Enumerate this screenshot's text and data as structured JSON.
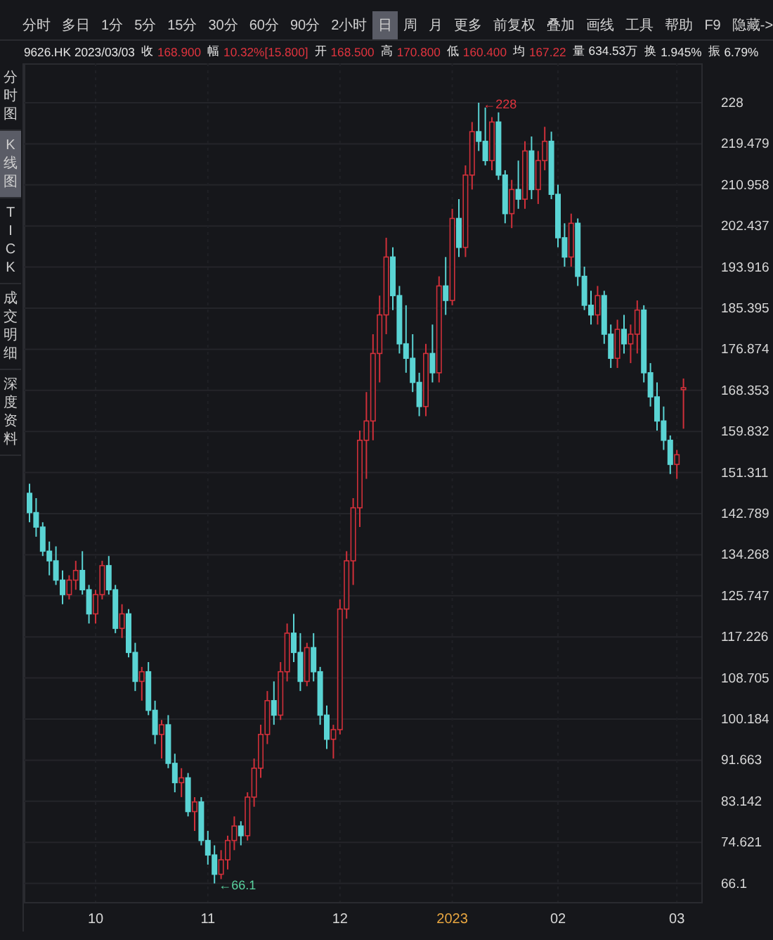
{
  "periods": [
    {
      "label": "分时",
      "selected": false
    },
    {
      "label": "多日",
      "selected": false
    },
    {
      "label": "1分",
      "selected": false
    },
    {
      "label": "5分",
      "selected": false
    },
    {
      "label": "15分",
      "selected": false
    },
    {
      "label": "30分",
      "selected": false
    },
    {
      "label": "60分",
      "selected": false
    },
    {
      "label": "90分",
      "selected": false
    },
    {
      "label": "2小时",
      "selected": false
    },
    {
      "label": "日",
      "selected": true
    },
    {
      "label": "周",
      "selected": false
    },
    {
      "label": "月",
      "selected": false
    },
    {
      "label": "更多",
      "selected": false
    }
  ],
  "tools": [
    "前复权",
    "叠加",
    "画线",
    "工具",
    "帮助",
    "F9",
    "隐藏->"
  ],
  "quote": {
    "symbol": "9626.HK",
    "date": "2023/03/03",
    "fields": [
      {
        "label": "收",
        "value": "168.900",
        "color": "#e0343e"
      },
      {
        "label": "幅",
        "value": "10.32%[15.800]",
        "color": "#e0343e"
      },
      {
        "label": "开",
        "value": "168.500",
        "color": "#e0343e"
      },
      {
        "label": "高",
        "value": "170.800",
        "color": "#e0343e"
      },
      {
        "label": "低",
        "value": "160.400",
        "color": "#e0343e"
      },
      {
        "label": "均",
        "value": "167.22",
        "color": "#e0343e"
      },
      {
        "label": "量",
        "value": "634.53万",
        "color": "#e6e6e6"
      },
      {
        "label": "换",
        "value": "1.945%",
        "color": "#e6e6e6"
      },
      {
        "label": "振",
        "value": "6.79%",
        "color": "#e6e6e6"
      }
    ]
  },
  "x_axis": [
    {
      "label": "10",
      "kind": "month"
    },
    {
      "label": "11",
      "kind": "month"
    },
    {
      "label": "12",
      "kind": "month"
    },
    {
      "label": "2023",
      "kind": "year"
    },
    {
      "label": "02",
      "kind": "month"
    },
    {
      "label": "03",
      "kind": "month"
    }
  ],
  "markers": [
    {
      "label": "←228",
      "kind": "high"
    },
    {
      "label": "←66.1",
      "kind": "low"
    }
  ],
  "side_tabs": [
    {
      "label": "分时图",
      "selected": false
    },
    {
      "label": "K线图",
      "selected": true
    },
    {
      "label": "TICK",
      "selected": false
    },
    {
      "label": "成交明细",
      "selected": false
    },
    {
      "label": "深度资料",
      "selected": false
    }
  ],
  "chart_data": {
    "type": "candlestick",
    "ylim": [
      66.1,
      228
    ],
    "yticks": [
      228,
      219.479,
      210.958,
      202.437,
      193.916,
      185.395,
      176.874,
      168.353,
      159.832,
      151.311,
      142.789,
      134.268,
      125.747,
      117.226,
      108.705,
      100.184,
      91.663,
      83.142,
      74.621,
      66.1
    ],
    "grid": true,
    "ohlc": [
      [
        147,
        149,
        141,
        143
      ],
      [
        143,
        146,
        138,
        140
      ],
      [
        140,
        141,
        134,
        135
      ],
      [
        135,
        137,
        130,
        133
      ],
      [
        133,
        136,
        128,
        129
      ],
      [
        129,
        131,
        124,
        126
      ],
      [
        126,
        130,
        125,
        129
      ],
      [
        129,
        133,
        127,
        131
      ],
      [
        131,
        135,
        126,
        127
      ],
      [
        127,
        128,
        120,
        122
      ],
      [
        122,
        127,
        120,
        126
      ],
      [
        126,
        133,
        125,
        132
      ],
      [
        132,
        134,
        126,
        127
      ],
      [
        127,
        128,
        118,
        119
      ],
      [
        119,
        124,
        117,
        122
      ],
      [
        122,
        123,
        113,
        114
      ],
      [
        114,
        116,
        106,
        108
      ],
      [
        108,
        111,
        104,
        110
      ],
      [
        110,
        112,
        101,
        102
      ],
      [
        102,
        104,
        95,
        97
      ],
      [
        97,
        100,
        92,
        99
      ],
      [
        99,
        101,
        90,
        91
      ],
      [
        91,
        93,
        85,
        87
      ],
      [
        87,
        90,
        84,
        88
      ],
      [
        88,
        89,
        80,
        81
      ],
      [
        81,
        84,
        77,
        83
      ],
      [
        83,
        84,
        74,
        75
      ],
      [
        75,
        77,
        70,
        72
      ],
      [
        72,
        74,
        66.1,
        68
      ],
      [
        68,
        73,
        67,
        71
      ],
      [
        71,
        76,
        69,
        75
      ],
      [
        75,
        80,
        73,
        78
      ],
      [
        78,
        79,
        74,
        76
      ],
      [
        76,
        85,
        75,
        84
      ],
      [
        84,
        92,
        82,
        90
      ],
      [
        90,
        99,
        88,
        97
      ],
      [
        97,
        106,
        95,
        104
      ],
      [
        104,
        108,
        99,
        101
      ],
      [
        101,
        112,
        100,
        110
      ],
      [
        110,
        120,
        108,
        118
      ],
      [
        118,
        122,
        112,
        114
      ],
      [
        114,
        118,
        106,
        108
      ],
      [
        108,
        116,
        107,
        115
      ],
      [
        115,
        118,
        108,
        110
      ],
      [
        110,
        111,
        99,
        101
      ],
      [
        101,
        103,
        94,
        96
      ],
      [
        96,
        99,
        92,
        98
      ],
      [
        98,
        125,
        97,
        123
      ],
      [
        123,
        135,
        121,
        133
      ],
      [
        133,
        146,
        128,
        144
      ],
      [
        144,
        160,
        140,
        158
      ],
      [
        158,
        168,
        150,
        162
      ],
      [
        162,
        180,
        158,
        176
      ],
      [
        176,
        188,
        170,
        184
      ],
      [
        184,
        200,
        180,
        196
      ],
      [
        196,
        198,
        185,
        188
      ],
      [
        188,
        190,
        176,
        178
      ],
      [
        178,
        186,
        172,
        175
      ],
      [
        175,
        180,
        168,
        170
      ],
      [
        170,
        172,
        163,
        165
      ],
      [
        165,
        178,
        163,
        176
      ],
      [
        176,
        182,
        170,
        172
      ],
      [
        172,
        192,
        170,
        190
      ],
      [
        190,
        196,
        184,
        187
      ],
      [
        187,
        206,
        186,
        204
      ],
      [
        204,
        208,
        196,
        198
      ],
      [
        198,
        215,
        196,
        213
      ],
      [
        213,
        224,
        210,
        222
      ],
      [
        222,
        228,
        218,
        220
      ],
      [
        220,
        227,
        215,
        216
      ],
      [
        216,
        225,
        214,
        224
      ],
      [
        224,
        226,
        212,
        213
      ],
      [
        213,
        214,
        203,
        205
      ],
      [
        205,
        212,
        202,
        210
      ],
      [
        210,
        216,
        206,
        208
      ],
      [
        208,
        220,
        206,
        218
      ],
      [
        218,
        221,
        208,
        210
      ],
      [
        210,
        218,
        207,
        216
      ],
      [
        216,
        223,
        214,
        220
      ],
      [
        220,
        222,
        208,
        209
      ],
      [
        209,
        211,
        198,
        200
      ],
      [
        200,
        203,
        194,
        196
      ],
      [
        196,
        205,
        194,
        203
      ],
      [
        203,
        204,
        190,
        192
      ],
      [
        192,
        194,
        185,
        186
      ],
      [
        186,
        189,
        182,
        184
      ],
      [
        184,
        190,
        182,
        188
      ],
      [
        188,
        189,
        178,
        180
      ],
      [
        180,
        182,
        173,
        175
      ],
      [
        175,
        183,
        173,
        181
      ],
      [
        181,
        184,
        176,
        178
      ],
      [
        178,
        182,
        174,
        180
      ],
      [
        180,
        187,
        176,
        185
      ],
      [
        185,
        186,
        170,
        172
      ],
      [
        172,
        174,
        165,
        167
      ],
      [
        167,
        170,
        160,
        162
      ],
      [
        162,
        165,
        156,
        158
      ],
      [
        158,
        159,
        151,
        153
      ],
      [
        153,
        156,
        150,
        155
      ],
      [
        168.5,
        170.8,
        160.4,
        168.9
      ]
    ]
  }
}
